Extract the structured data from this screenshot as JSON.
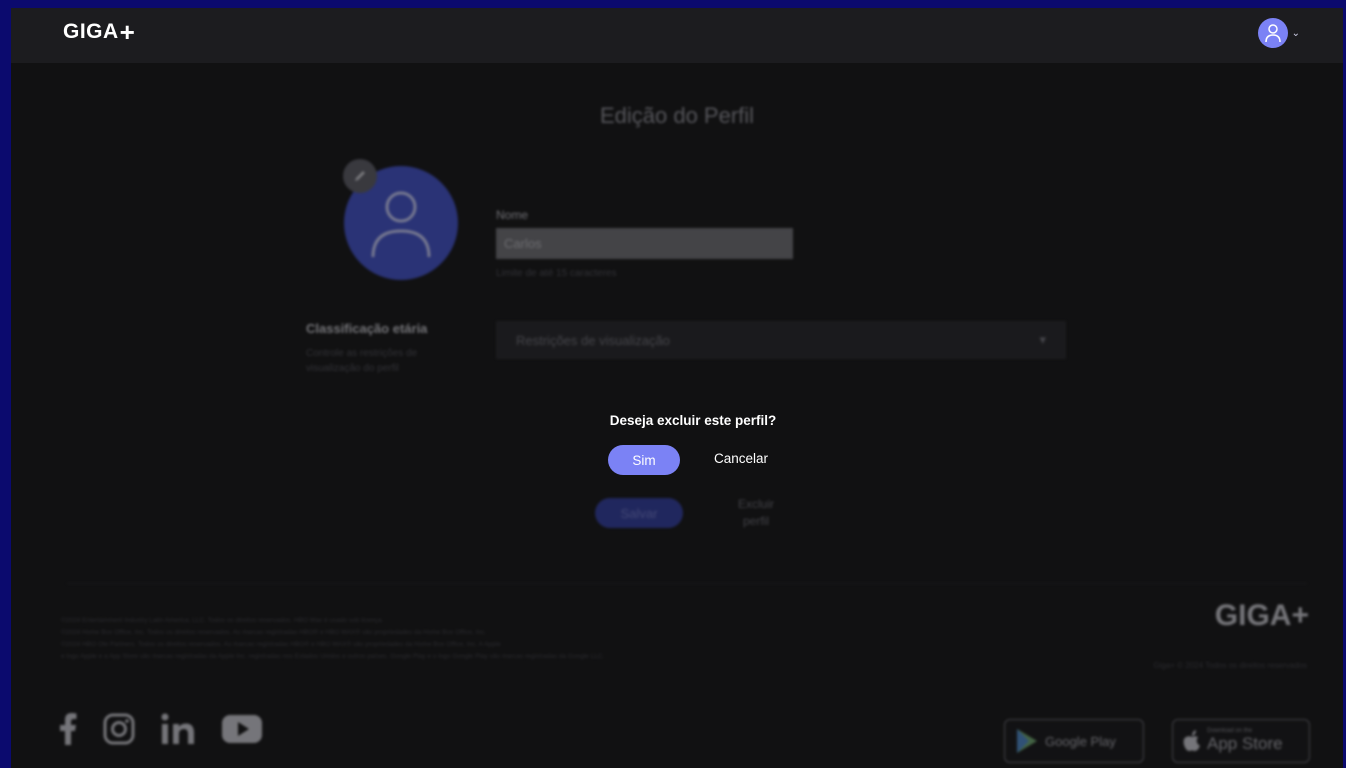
{
  "header": {
    "logo_text": "GIGA",
    "logo_plus": "+",
    "logo_mini": "",
    "avatar_color": "#7b82f5"
  },
  "profile_form": {
    "page_title": "Edição do Perfil",
    "name_label": "Nome",
    "name_value": "Carlos",
    "name_hint": "Limite de até 15 caracteres",
    "rating_title": "Classificação etária",
    "rating_description": "Controle as restrições de visualização do perfil",
    "rating_select": "Restrições de visualização",
    "save_label": "Salvar",
    "delete_label_line1": "Excluir",
    "delete_label_line2": "perfil"
  },
  "dialog": {
    "question": "Deseja excluir este perfil?",
    "yes_label": "Sim",
    "cancel_label": "Cancelar"
  },
  "footer": {
    "legal_lines": [
      "©2024 Entertainment Industry Latin America, LLC. Todos os direitos reservados. HBO Max é usado sob licença.",
      "©2024 Home Box Office, Inc. Todos os direitos reservados. As marcas registradas HBO® e HBO MAX® são propriedades da Home Box Office, Inc.",
      "©2024 HBO Ole Partners. Todos os direitos reservados. As marcas registradas HBO® e HBO MAX® são propriedades da Home Box Office, Inc. A Apple",
      "e logo Apple e a App Store são marcas registradas da Apple Inc. registradas nos Estados Unidos e outros países. Google Play e o logo Google Play são marcas registradas da Google LLC."
    ],
    "logo_text": "GIGA",
    "logo_plus": "+",
    "copyright": "Giga+ © 2024 Todos os direitos reservados",
    "google_play_label": "Google Play",
    "app_store_small": "Download on the",
    "app_store_label": "App Store"
  }
}
